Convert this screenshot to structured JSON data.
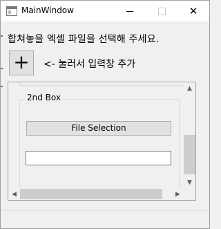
{
  "window": {
    "title": "MainWindow",
    "controls": {
      "minimize": "–",
      "maximize": "☐",
      "close": "✕"
    }
  },
  "main": {
    "instruction": "합쳐놓을 엑셀 파일을 선택해 주세요.",
    "add_button_label": "+",
    "add_hint": "<- 눌러서 입력창 추가"
  },
  "groupbox": {
    "title": "2nd Box",
    "file_button_label": "File Selection",
    "path_value": ""
  },
  "scrollbars": {
    "up_arrow": "▲",
    "down_arrow": "▼",
    "left_arrow": "◀",
    "right_arrow": "▶"
  }
}
